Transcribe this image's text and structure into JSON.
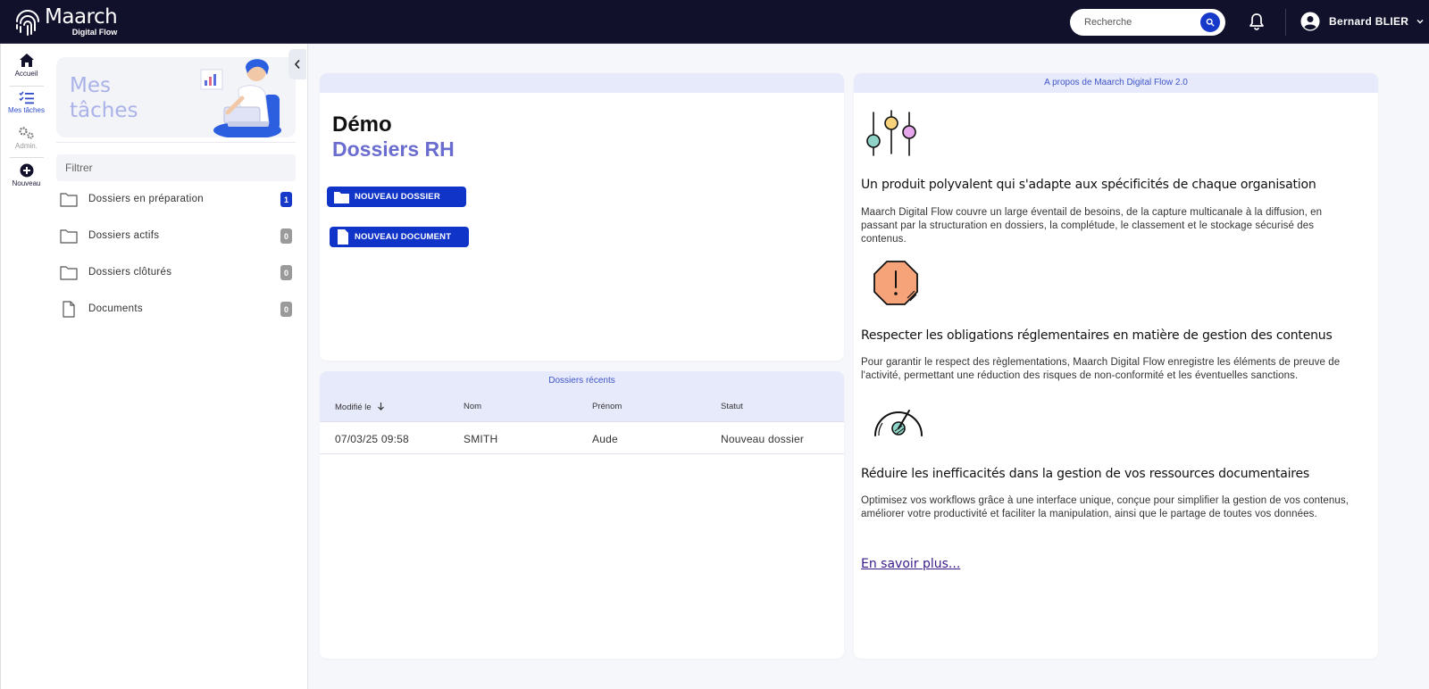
{
  "app": {
    "brand": "Maarch",
    "brand_sub": "Digital Flow"
  },
  "header": {
    "search_placeholder": "Recherche",
    "user_name": "Bernard BLIER"
  },
  "rail": {
    "home": "Accueil",
    "tasks": "Mes tâches",
    "admin": "Admin.",
    "new": "Nouveau"
  },
  "tasks_panel": {
    "title": "Mes tâches",
    "filter_placeholder": "Filtrer",
    "items": [
      {
        "label": "Dossiers en préparation",
        "count": "1",
        "icon": "folder-icon"
      },
      {
        "label": "Dossiers actifs",
        "count": "0",
        "icon": "folder-icon"
      },
      {
        "label": "Dossiers clôturés",
        "count": "0",
        "icon": "folder-icon"
      },
      {
        "label": "Documents",
        "count": "0",
        "icon": "document-icon"
      }
    ]
  },
  "demo_card": {
    "title": "Démo",
    "subtitle": "Dossiers RH",
    "new_folder_button": "NOUVEAU DOSSIER",
    "new_document_button": "NOUVEAU DOCUMENT"
  },
  "recent": {
    "title": "Dossiers récents",
    "columns": [
      "Modifié le",
      "Nom",
      "Prénom",
      "Statut"
    ],
    "rows": [
      [
        "07/03/25 09:58",
        "SMITH",
        "Aude",
        "Nouveau dossier"
      ]
    ]
  },
  "about": {
    "title": "A propos de Maarch Digital Flow 2.0",
    "sections": [
      {
        "heading": "Un produit polyvalent qui s'adapte aux spécificités de chaque organisation",
        "text_line1": "Maarch Digital Flow couvre un large éventail de besoins, de la capture multicanale à la diffusion, en",
        "text_line2": "passant par la structuration en dossiers, la complétude, le classement et le stockage sécurisé des",
        "text_line3": "contenus."
      },
      {
        "heading": "Respecter les obligations réglementaires en matière de gestion des contenus",
        "text_line1": "Pour garantir le respect des règlementations, Maarch Digital Flow enregistre les éléments de preuve de",
        "text_line2": "l'activité, permettant une réduction des risques de non-conformité et les éventuelles sanctions."
      },
      {
        "heading": "Réduire les inefficacités dans la gestion de vos ressources documentaires",
        "text_line1": "Optimisez vos workflows grâce à une interface unique, conçue pour simplifier la gestion de vos contenus,",
        "text_line2": "améliorer votre productivité et faciliter la manipulation, ainsi que le partage de toutes vos données."
      }
    ],
    "more_link": "En savoir plus..."
  },
  "colors": {
    "topbar": "#11112c",
    "accent": "#1034c7",
    "subtitle": "#6a6dcf",
    "badge_active": "#1739c9",
    "badge_muted": "#9a9a9a"
  }
}
